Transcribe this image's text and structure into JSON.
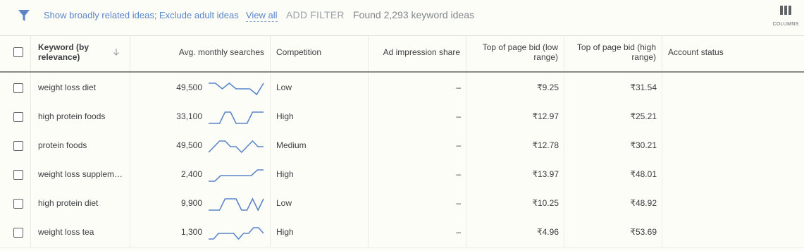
{
  "filters": {
    "related_label": "Show broadly related ideas;",
    "adult_label": "Exclude adult ideas",
    "view_all_label": "View all",
    "add_filter_label": "ADD FILTER",
    "found_text": "Found 2,293 keyword ideas",
    "columns_label": "COLUMNS"
  },
  "colors": {
    "accent": "#5b85c8",
    "sparkline": "#5b85c8"
  },
  "table": {
    "headers": {
      "keyword": "Keyword (by relevance)",
      "searches": "Avg. monthly searches",
      "competition": "Competition",
      "impression_share": "Ad impression share",
      "bid_low": "Top of page bid (low range)",
      "bid_high": "Top of page bid (high range)",
      "account_status": "Account status"
    },
    "rows": [
      {
        "keyword": "weight loss diet",
        "searches": "49,500",
        "trend": [
          2,
          2,
          1,
          2,
          1,
          1,
          1,
          0,
          2
        ],
        "competition": "Low",
        "impression": "–",
        "bid_low": "₹9.25",
        "bid_high": "₹31.54",
        "status": ""
      },
      {
        "keyword": "high protein foods",
        "searches": "33,100",
        "trend": [
          0,
          0,
          0,
          2,
          2,
          0,
          0,
          0,
          2,
          2,
          2
        ],
        "competition": "High",
        "impression": "–",
        "bid_low": "₹12.97",
        "bid_high": "₹25.21",
        "status": ""
      },
      {
        "keyword": "protein foods",
        "searches": "49,500",
        "trend": [
          0,
          1,
          2,
          2,
          1,
          1,
          0,
          1,
          2,
          1,
          1
        ],
        "competition": "Medium",
        "impression": "–",
        "bid_low": "₹12.78",
        "bid_high": "₹30.21",
        "status": ""
      },
      {
        "keyword": "weight loss supplem…",
        "searches": "2,400",
        "trend": [
          0,
          0,
          1,
          1,
          1,
          1,
          1,
          1,
          2,
          2
        ],
        "competition": "High",
        "impression": "–",
        "bid_low": "₹13.97",
        "bid_high": "₹48.01",
        "status": ""
      },
      {
        "keyword": "high protein diet",
        "searches": "9,900",
        "trend": [
          0,
          0,
          0,
          2,
          2,
          2,
          0,
          0,
          2,
          0,
          2
        ],
        "competition": "Low",
        "impression": "–",
        "bid_low": "₹10.25",
        "bid_high": "₹48.92",
        "status": ""
      },
      {
        "keyword": "weight loss tea",
        "searches": "1,300",
        "trend": [
          0,
          0,
          1,
          1,
          1,
          1,
          0,
          1,
          1,
          2,
          2,
          1
        ],
        "competition": "High",
        "impression": "–",
        "bid_low": "₹4.96",
        "bid_high": "₹53.69",
        "status": ""
      }
    ]
  }
}
